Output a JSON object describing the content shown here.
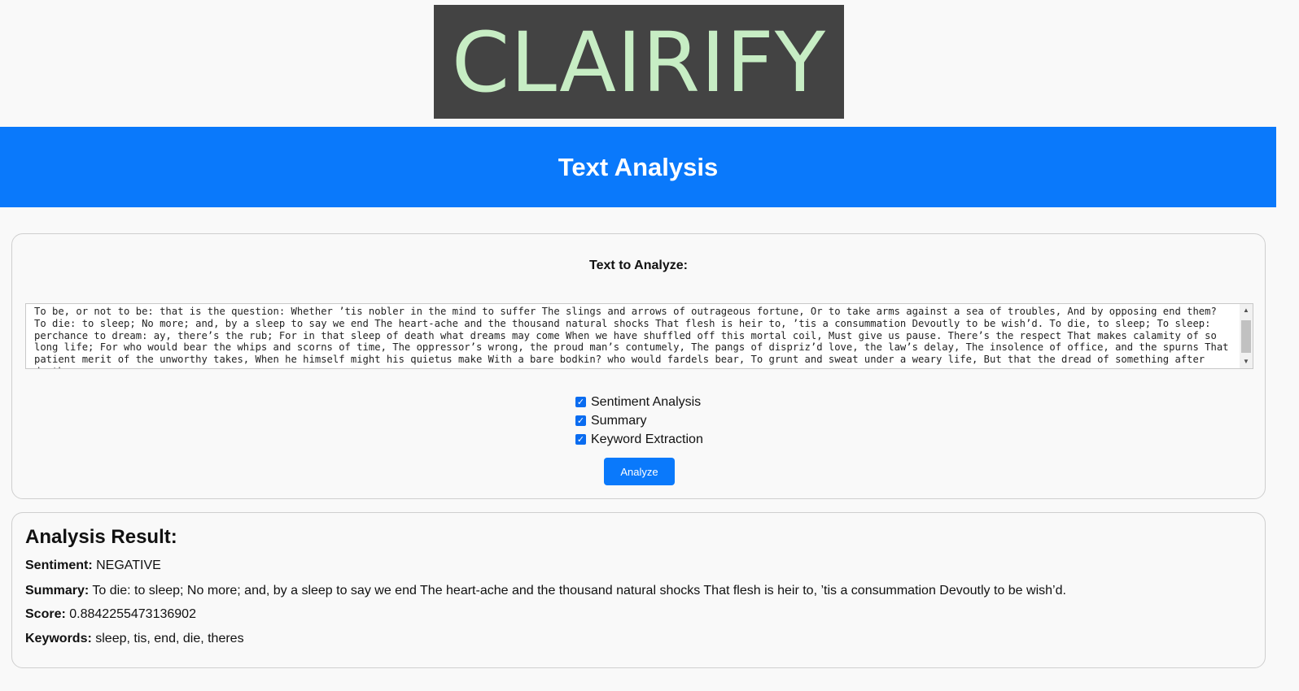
{
  "logo": {
    "text": "CLAIRIFY"
  },
  "banner": {
    "title": "Text Analysis"
  },
  "input": {
    "label": "Text to Analyze:",
    "text": "To be, or not to be: that is the question: Whether ’tis nobler in the mind to suffer The slings and arrows of outrageous fortune, Or to take arms against a sea of troubles, And by opposing end them? To die: to sleep; No more; and, by a sleep to say we end The heart-ache and the thousand natural shocks That flesh is heir to, ’tis a consummation Devoutly to be wish’d. To die, to sleep; To sleep: perchance to dream: ay, there’s the rub; For in that sleep of death what dreams may come When we have shuffled off this mortal coil, Must give us pause. There’s the respect That makes calamity of so long life; For who would bear the whips and scorns of time, The oppressor’s wrong, the proud man’s contumely, The pangs of dispriz’d love, the law’s delay, The insolence of office, and the spurns That patient merit of the unworthy takes, When he himself might his quietus make With a bare bodkin? who would fardels bear, To grunt and sweat under a weary life, But that the dread of something after death"
  },
  "options": [
    {
      "label": "Sentiment Analysis",
      "checked": true
    },
    {
      "label": "Summary",
      "checked": true
    },
    {
      "label": "Keyword Extraction",
      "checked": true
    }
  ],
  "analyze_button": "Analyze",
  "result": {
    "title": "Analysis Result:",
    "sentiment_label": "Sentiment:",
    "sentiment_value": "NEGATIVE",
    "summary_label": "Summary:",
    "summary_value": "To die: to sleep; No more; and, by a sleep to say we end The heart-ache and the thousand natural shocks That flesh is heir to, ’tis a consummation Devoutly to be wish’d.",
    "score_label": "Score:",
    "score_value": "0.8842255473136902",
    "keywords_label": "Keywords:",
    "keywords_value": "sleep, tis, end, die, theres"
  },
  "colors": {
    "banner": "#0a79fb",
    "logo_bg": "#434343",
    "logo_text": "#c7edc4",
    "button": "#0a79fb"
  },
  "icons": {
    "scroll_up": "scroll-up-arrow-icon",
    "scroll_down": "scroll-down-arrow-icon",
    "checkbox": "checkmark-icon"
  }
}
